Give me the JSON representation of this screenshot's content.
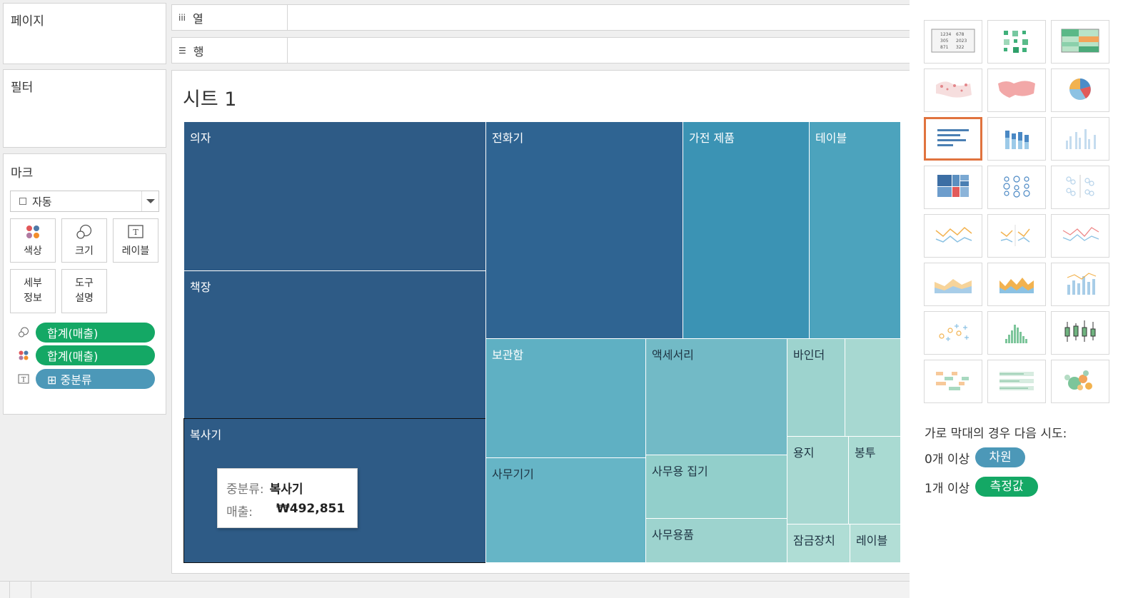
{
  "left_panel": {
    "pages_title": "페이지",
    "filters_title": "필터",
    "marks_title": "마크",
    "mark_type": "자동",
    "mark_buttons": {
      "color": "색상",
      "size": "크기",
      "label": "레이블",
      "detail_line1": "세부",
      "detail_line2": "정보",
      "tooltip_line1": "도구",
      "tooltip_line2": "설명"
    },
    "pills": [
      {
        "icon": "size-icon",
        "text": "합계(매출)",
        "color": "#14a865"
      },
      {
        "icon": "color-icon",
        "text": "합계(매출)",
        "color": "#14a865"
      },
      {
        "icon": "label-icon",
        "text": "⊞ 중분류",
        "color": "#4c98b8"
      }
    ]
  },
  "shelves": {
    "columns_label": "열",
    "rows_label": "행"
  },
  "view": {
    "sheet_title": "시트 1",
    "treemap": [
      {
        "label": "의자",
        "fill": "#2e5b86"
      },
      {
        "label": "책장",
        "fill": "#2e5b86"
      },
      {
        "label": "복사기",
        "fill": "#2e5b86"
      },
      {
        "label": "전화기",
        "fill": "#2f6492"
      },
      {
        "label": "가전 제품",
        "fill": "#3b93b4"
      },
      {
        "label": "테이블",
        "fill": "#4ca3bd"
      },
      {
        "label": "보관함",
        "fill": "#5fb0c3"
      },
      {
        "label": "사무기기",
        "fill": "#66b5c6"
      },
      {
        "label": "액세서리",
        "fill": "#72bac6"
      },
      {
        "label": "사무용 집기",
        "fill": "#92cfcb"
      },
      {
        "label": "사무용품",
        "fill": "#9dd3ce"
      },
      {
        "label": "바인더",
        "fill": "#9dd3ce"
      },
      {
        "label": "",
        "fill": "#a7d8d1"
      },
      {
        "label": "용지",
        "fill": "#a7d8d1"
      },
      {
        "label": "봉투",
        "fill": "#a9dad2"
      },
      {
        "label": "잠금장치",
        "fill": "#afddd5"
      },
      {
        "label": "레이블",
        "fill": "#b2ded6"
      }
    ],
    "tooltip": {
      "key1": "중분류:",
      "val1": "복사기",
      "key2": "매출:",
      "val2": "₩492,851"
    }
  },
  "show_me": {
    "charts": [
      "text-table-icon",
      "heat-map-icon",
      "highlight-table-icon",
      "symbol-map-icon",
      "filled-map-icon",
      "pie-chart-icon",
      "horizontal-bar-icon",
      "stacked-bar-icon",
      "side-by-side-bar-icon",
      "treemap-icon",
      "circle-view-icon",
      "side-by-side-circles-icon",
      "continuous-line-icon",
      "discrete-line-icon",
      "dual-line-icon",
      "continuous-area-icon",
      "discrete-area-icon",
      "dual-combination-icon",
      "scatter-plot-icon",
      "histogram-icon",
      "box-whisker-icon",
      "gantt-chart-icon",
      "bullet-graph-icon",
      "packed-bubbles-icon"
    ],
    "selected_index": 6,
    "hint": "가로 막대의 경우 다음 시도:",
    "req1_text": "0개 이상",
    "req1_pill": "차원",
    "req1_color": "#4c98b8",
    "req2_text": "1개 이상",
    "req2_pill": "측정값",
    "req2_color": "#14a865"
  }
}
